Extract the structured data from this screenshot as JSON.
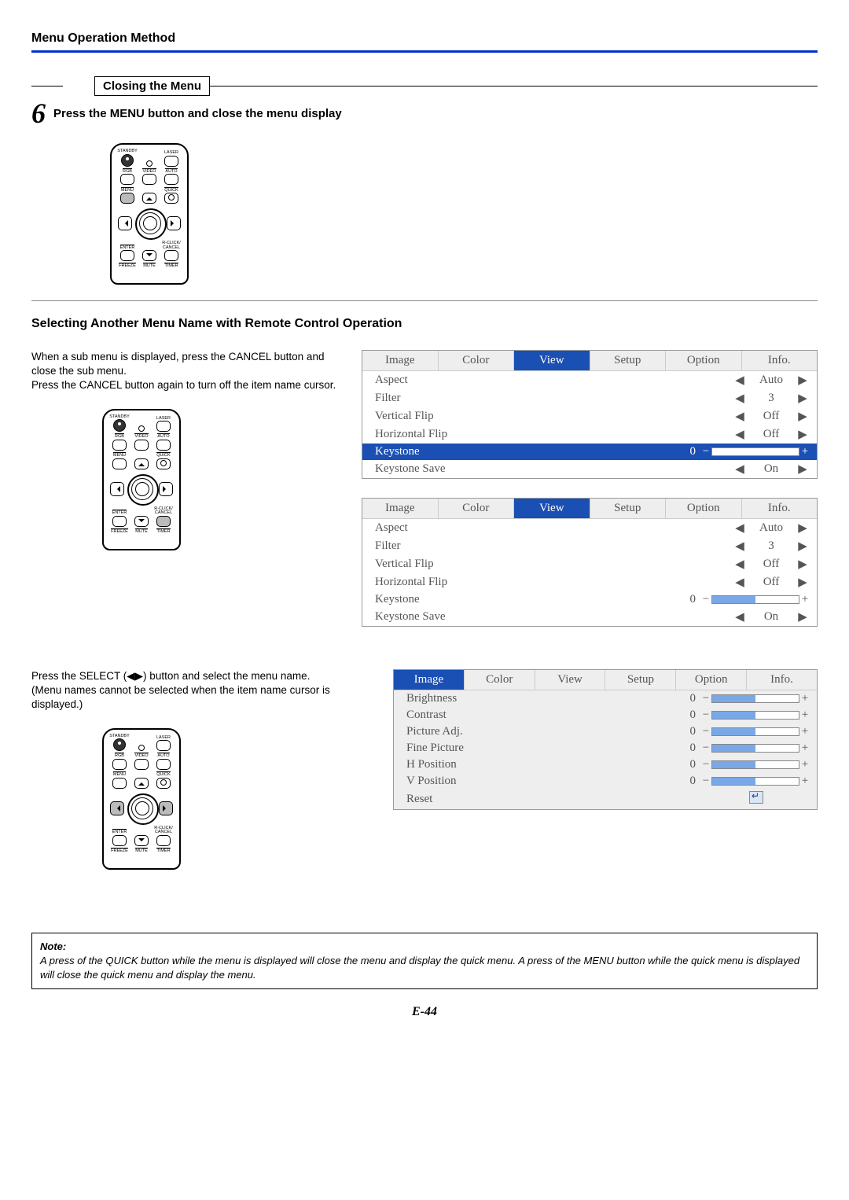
{
  "header": {
    "title": "Menu Operation Method"
  },
  "step6": {
    "box_title": "Closing the Menu",
    "num": "6",
    "text": "Press the MENU button and close the menu display"
  },
  "section2": {
    "title": "Selecting Another Menu Name with Remote Control Operation",
    "para1": "When a sub menu is displayed, press the CANCEL button and close the sub menu.",
    "para2": "Press the CANCEL button again to turn off the item name cursor.",
    "para3": "Press the SELECT (◀▶) button and select the menu name.",
    "para4": "(Menu names cannot be selected when the item name cursor is displayed.)"
  },
  "osd_tabs": [
    "Image",
    "Color",
    "View",
    "Setup",
    "Option",
    "Info."
  ],
  "osd_view_rows": [
    {
      "label": "Aspect",
      "type": "enum",
      "value": "Auto"
    },
    {
      "label": "Filter",
      "type": "enum",
      "value": "3"
    },
    {
      "label": "Vertical Flip",
      "type": "enum",
      "value": "Off"
    },
    {
      "label": "Horizontal Flip",
      "type": "enum",
      "value": "Off"
    },
    {
      "label": "Keystone",
      "type": "slider",
      "value": "0"
    },
    {
      "label": "Keystone Save",
      "type": "enum",
      "value": "On"
    }
  ],
  "osd_image_rows": [
    {
      "label": "Brightness",
      "value": "0"
    },
    {
      "label": "Contrast",
      "value": "0"
    },
    {
      "label": "Picture Adj.",
      "value": "0"
    },
    {
      "label": "Fine Picture",
      "value": "0"
    },
    {
      "label": "H Position",
      "value": "0"
    },
    {
      "label": "V Position",
      "value": "0"
    },
    {
      "label": "Reset",
      "value": ""
    }
  ],
  "remote_labels": {
    "standby": "STANDBY",
    "laser": "LASER",
    "rgb": "RGB",
    "video": "VIDEO",
    "auto": "AUTO",
    "menu": "MENU",
    "quick": "QUICK",
    "enter": "ENTER",
    "rclick": "R-CLICK/",
    "cancel": "CANCEL",
    "freeze": "FREEZE",
    "mute": "MUTE",
    "timer": "TIMER"
  },
  "note": {
    "head": "Note:",
    "body": "A press of the QUICK button while the menu is displayed will close the menu and display the quick menu. A press of the MENU button while the quick menu is displayed will close the quick menu and display the menu."
  },
  "page_number": "E-44"
}
